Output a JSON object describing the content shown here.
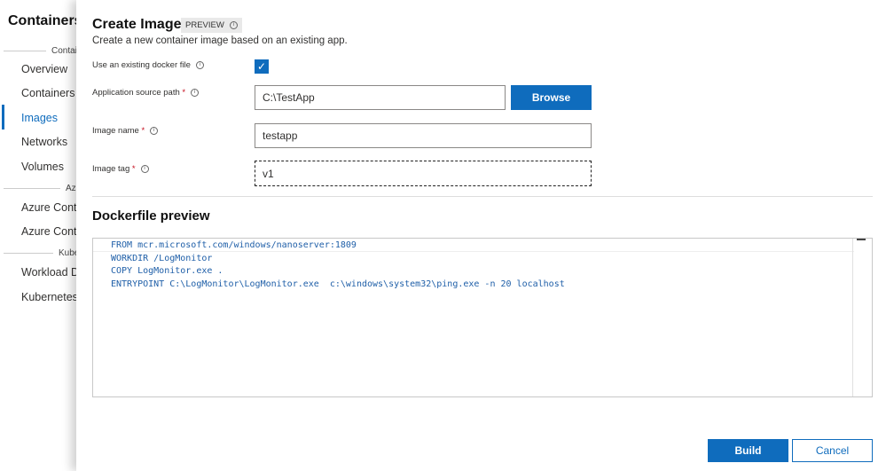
{
  "sidebar": {
    "title": "Containers",
    "sections": [
      "Containers",
      "Azure",
      "Kubernetes"
    ],
    "items": [
      "Overview",
      "Containers",
      "Images",
      "Networks",
      "Volumes",
      "Azure Container Registry",
      "Azure Container Instances",
      "Workload Deployments",
      "Kubernetes Services"
    ],
    "active": "Images"
  },
  "panel": {
    "title": "Create Image",
    "badge": "PREVIEW",
    "subtitle": "Create a new container image based on an existing app.",
    "fields": {
      "dockerfile": {
        "label": "Use an existing docker file",
        "checked": true
      },
      "source": {
        "label": "Application source path",
        "value": "C:\\TestApp",
        "button": "Browse"
      },
      "name": {
        "label": "Image name",
        "value": "testapp"
      },
      "tag": {
        "label": "Image tag",
        "value": "v1"
      }
    },
    "required_mark": "*",
    "preview_title": "Dockerfile preview",
    "code": "FROM mcr.microsoft.com/windows/nanoserver:1809\nWORKDIR /LogMonitor\nCOPY LogMonitor.exe .\nENTRYPOINT C:\\LogMonitor\\LogMonitor.exe  c:\\windows\\system32\\ping.exe -n 20 localhost",
    "build": "Build",
    "cancel": "Cancel"
  },
  "colors": {
    "accent": "#0f6cbd",
    "required": "#c50f1f"
  }
}
